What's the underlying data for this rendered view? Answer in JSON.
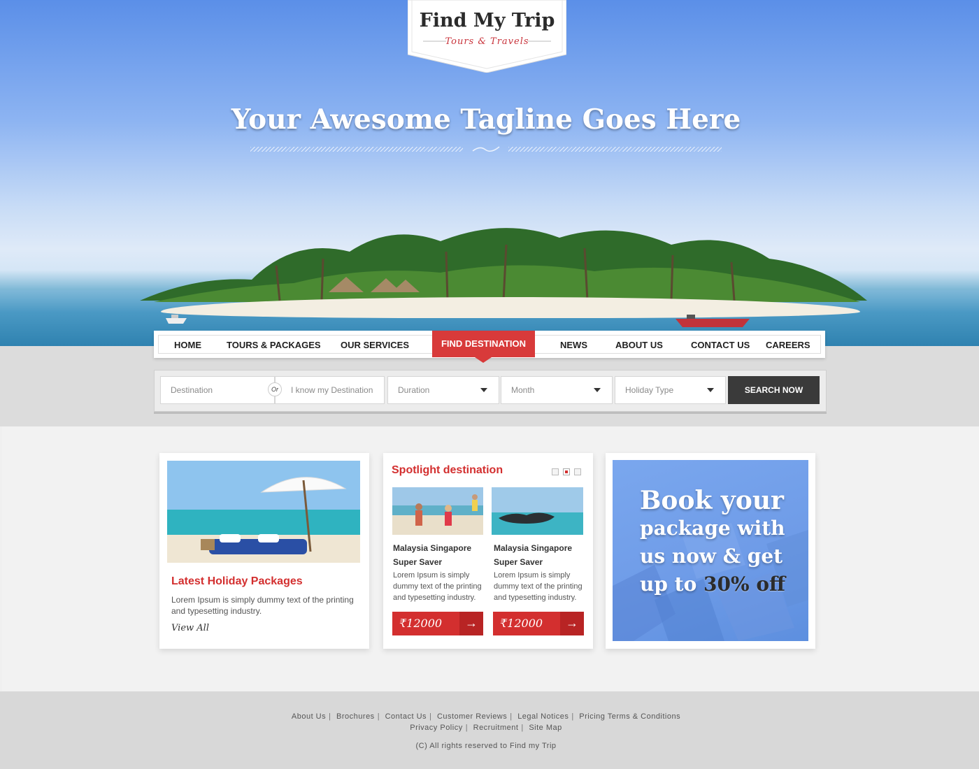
{
  "brand": {
    "name": "Find My Trip",
    "subtitle": "Tours & Travels"
  },
  "hero": {
    "tagline": "Your Awesome Tagline Goes Here"
  },
  "nav": {
    "items": [
      "HOME",
      "TOURS & PACKAGES",
      "OUR SERVICES",
      "FIND DESTINATION",
      "NEWS",
      "ABOUT US",
      "CONTACT US",
      "CAREERS"
    ],
    "active": "FIND DESTINATION"
  },
  "search": {
    "destination_placeholder": "Destination",
    "or_label": "Or",
    "known_destination_placeholder": "I know my Destination",
    "duration_label": "Duration",
    "month_label": "Month",
    "holiday_type_label": "Holiday Type",
    "button_label": "SEARCH NOW"
  },
  "latest": {
    "title": "Latest Holiday Packages",
    "description": "Lorem Ipsum is simply dummy text of the printing and typesetting industry.",
    "link": "View All"
  },
  "spotlight": {
    "title": "Spotlight destination",
    "items": [
      {
        "name": "Malaysia Singapore Super Saver",
        "description": "Lorem Ipsum is simply dummy text of the printing and typesetting industry.",
        "price": "₹12000"
      },
      {
        "name": "Malaysia Singapore Super Saver",
        "description": "Lorem Ipsum is simply dummy text of the printing and typesetting industry.",
        "price": "₹12000"
      }
    ],
    "arrow": "→"
  },
  "promo": {
    "line1": "Book your",
    "line2": "package with",
    "line3": "us now & get",
    "line4_prefix": "up to",
    "line4_highlight": "30% off"
  },
  "footer": {
    "row1": [
      "About Us",
      "Brochures",
      "Contact Us",
      "Customer Reviews",
      "Legal Notices",
      "Pricing Terms & Conditions"
    ],
    "row2": [
      "Privacy Policy",
      "Recruitment",
      "Site Map"
    ],
    "copyright": "(C) All rights reserved to Find my Trip"
  },
  "colors": {
    "accent": "#d32f2f",
    "dark_button": "#3a3a3a",
    "sky": "#5b8fe8"
  }
}
